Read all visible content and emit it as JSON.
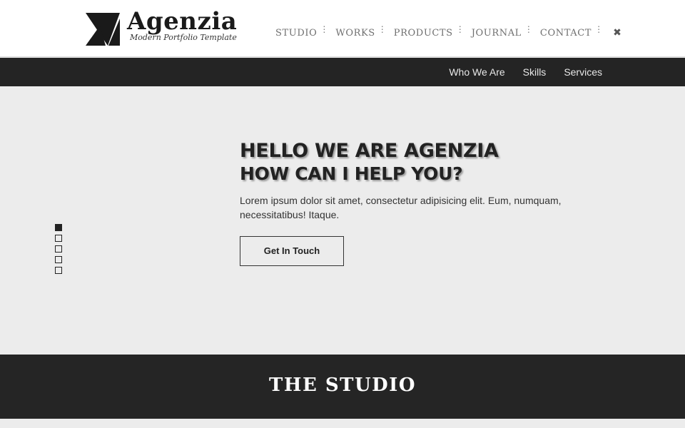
{
  "brand": {
    "title": "Agenzia",
    "tagline": "Modern Portfolio Template",
    "logo_icon": "triangle-logo-icon"
  },
  "main_nav": {
    "items": [
      {
        "label": "STUDIO"
      },
      {
        "label": "WORKS"
      },
      {
        "label": "PRODUCTS"
      },
      {
        "label": "JOURNAL"
      },
      {
        "label": "CONTACT"
      }
    ],
    "close_icon": "close-x-icon"
  },
  "sub_nav": {
    "items": [
      {
        "label": "Who We Are"
      },
      {
        "label": "Skills"
      },
      {
        "label": "Services"
      }
    ]
  },
  "hero": {
    "heading_line1": "HELLO WE ARE AGENZIA",
    "heading_line2": "HOW CAN I HELP YOU?",
    "text": "Lorem ipsum dolor sit amet, consectetur adipisicing elit. Eum, numquam, necessitatibus! Itaque.",
    "button_label": "Get In Touch",
    "slide_count": 5,
    "active_slide": 1
  },
  "section": {
    "title": "THE STUDIO"
  },
  "colors": {
    "header_bg": "#ffffff",
    "subnav_bg": "#242424",
    "hero_bg": "#ececec",
    "band_bg": "#252525",
    "text_dark": "#222222"
  }
}
